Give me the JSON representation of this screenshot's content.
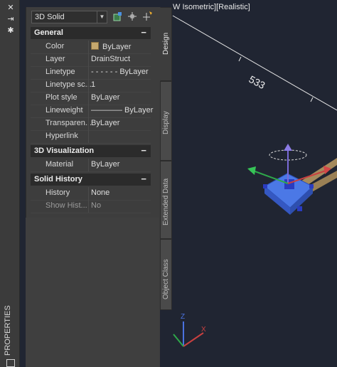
{
  "viewport": {
    "label": "W Isometric][Realistic]",
    "dimension_text": "533"
  },
  "strip": {
    "title": "PROPERTIES",
    "close_icon": "close-icon",
    "autohide_icon": "autohide-icon",
    "settings_icon": "settings-icon"
  },
  "selector": {
    "value": "3D Solid"
  },
  "toolbar": {
    "icons": [
      "toggle-pickadd-icon",
      "select-objects-icon",
      "quick-select-icon"
    ]
  },
  "sections": {
    "general": {
      "title": "General",
      "toggle": "−",
      "rows": [
        {
          "name": "Color",
          "value": "ByLayer"
        },
        {
          "name": "Layer",
          "value": "DrainStruct"
        },
        {
          "name": "Linetype",
          "value": "- - - - - - ByLayer"
        },
        {
          "name": "Linetype sc...",
          "value": "1"
        },
        {
          "name": "Plot style",
          "value": "ByLayer"
        },
        {
          "name": "Lineweight",
          "value": "———— ByLayer"
        },
        {
          "name": "Transparen...",
          "value": "ByLayer"
        },
        {
          "name": "Hyperlink",
          "value": ""
        }
      ]
    },
    "visualization": {
      "title": "3D Visualization",
      "toggle": "−",
      "rows": [
        {
          "name": "Material",
          "value": "ByLayer"
        }
      ]
    },
    "history": {
      "title": "Solid History",
      "toggle": "−",
      "rows": [
        {
          "name": "History",
          "value": "None"
        },
        {
          "name": "Show Hist...",
          "value": "No"
        }
      ]
    }
  },
  "tabs": [
    {
      "label": "Design",
      "active": true
    },
    {
      "label": "Display",
      "active": false
    },
    {
      "label": "Extended Data",
      "active": false
    },
    {
      "label": "Object Class",
      "active": false
    }
  ],
  "colors": {
    "color_swatch": "#c7a96e",
    "selection_blue": "#3d6fe0",
    "panel_bg": "#3d3d3d"
  }
}
